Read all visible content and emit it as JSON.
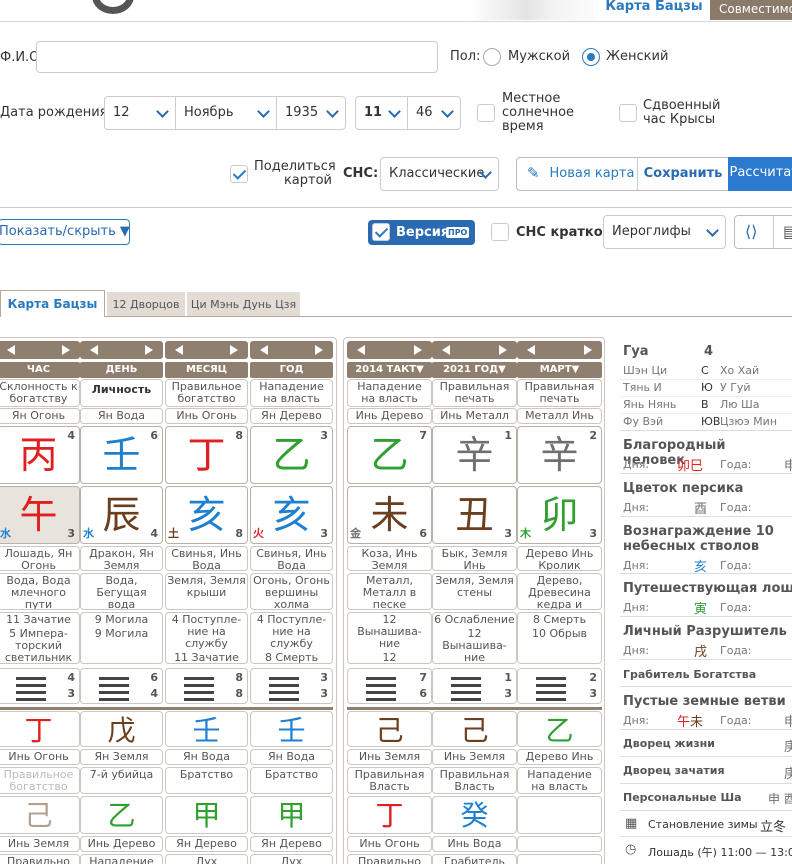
{
  "header": {
    "tab_main": "Карта Бацзы",
    "tab_compat": "Совместимость"
  },
  "form": {
    "fio_label": "Ф.И.О.",
    "fio_value": "",
    "sex_label": "Пол:",
    "male": "Мужской",
    "female": "Женский",
    "sex_selected": "Женский",
    "dob_label": "Дата рождения",
    "day": "12",
    "month": "Ноябрь",
    "year": "1935",
    "hour": "11",
    "minute": "46",
    "local_solar": "Местное солнечное время",
    "double_rat": "Сдвоенный час Крысы",
    "share_label": "Поделиться картой",
    "cnc_label": "СНС:",
    "cnc_value": "Классические",
    "new_card": "Новая карта",
    "save": "Сохранить",
    "calc": "Рассчитать"
  },
  "toolbar": {
    "show_hide": "Показать/скрыть ▼",
    "version": "Версия",
    "pro": "ПРО",
    "cnc_short": "СНС кратко",
    "hieroglyphs": "Иероглифы"
  },
  "chart_tabs": [
    "Карта Бацзы",
    "12 Дворцов",
    "Ци Мэнь Дунь Цзя"
  ],
  "left": {
    "heads": [
      "ЧАС",
      "ДЕНЬ",
      "МЕСЯЦ",
      "ГОД"
    ],
    "gods": [
      "Склонность к богатству",
      "Личность",
      "Правильное богатство",
      "Нападение на власть"
    ],
    "stem_lbl": [
      "Ян Огонь",
      "Ян Вода",
      "Инь Огонь",
      "Ян Дерево"
    ],
    "stems": [
      "丙",
      "壬",
      "丁",
      "乙"
    ],
    "stem_nums": [
      "4",
      "6",
      "8",
      "3"
    ],
    "branches": [
      "午",
      "辰",
      "亥",
      "亥"
    ],
    "branch_el": [
      "水",
      "水",
      "土",
      "火"
    ],
    "branch_nums": [
      "3",
      "4",
      "8",
      "3"
    ],
    "animals": [
      "Лошадь, Ян Огонь",
      "Дракон, Ян Земля",
      "Свинья, Инь Вода",
      "Свинья, Инь Вода"
    ],
    "nayin": [
      "Вода, Вода млечного пути",
      "Вода, Бегущая вода",
      "Земля, Земля крыши",
      "Огонь, Огонь вершины холма"
    ],
    "stages": [
      [
        "11 Зачатие",
        "5 Импера-торский светильник"
      ],
      [
        "9 Могила",
        "9 Могила"
      ],
      [
        "4 Поступле-ние на службу",
        "11 Зачатие"
      ],
      [
        "4 Поступле-ние на службу",
        "8 Смерть"
      ]
    ],
    "hex_nums": [
      [
        "4",
        "3"
      ],
      [
        "6",
        "4"
      ],
      [
        "8",
        "8"
      ],
      [
        "3",
        "3"
      ]
    ],
    "hidden1": [
      "丁",
      "戊",
      "壬",
      "壬"
    ],
    "hidden1_lbl": [
      "Инь Огонь",
      "Ян Земля",
      "Ян Вода",
      "Ян Вода"
    ],
    "hidden1_god": [
      "Правильное богатство",
      "7-й убийца",
      "Братство",
      "Братство"
    ],
    "hidden2": [
      "己",
      "乙",
      "甲",
      "甲"
    ],
    "hidden2_lbl": [
      "Инь Земля",
      "Инь Дерево",
      "Ян Дерево",
      "Ян Дерево"
    ],
    "hidden2_god": [
      "Правильно",
      "Нападение на",
      "Дух",
      "Дух"
    ]
  },
  "mid": {
    "heads": [
      "2014 ТАКТ▼",
      "2021 ГОД▼",
      "МАРТ▼"
    ],
    "gods": [
      "Нападение на власть",
      "Правильная печать",
      "Правильная печать"
    ],
    "stem_lbl": [
      "Инь Дерево",
      "Инь Металл",
      "Металл Инь"
    ],
    "stems": [
      "乙",
      "辛",
      "辛"
    ],
    "stem_nums": [
      "7",
      "1",
      "2"
    ],
    "branches": [
      "未",
      "丑",
      "卯"
    ],
    "branch_el": [
      "金",
      "",
      ""
    ],
    "branch_el2": [
      "",
      "",
      "木"
    ],
    "branch_nums": [
      "6",
      "3",
      "3"
    ],
    "animals": [
      "Коза, Инь Земля",
      "Бык, Земля Инь",
      "Дерево Инь Кролик"
    ],
    "nayin": [
      "Металл, Металл в песке",
      "Земля, Земля стены",
      "Дерево, Древесина кедра и сосны"
    ],
    "stages": [
      [
        "12 Вынашива-ние",
        "12 Вынашива-ние"
      ],
      [
        "6 Ослабление",
        "12 Вынашива-ние"
      ],
      [
        "8 Смерть",
        "10 Обрыв"
      ]
    ],
    "hex_nums": [
      [
        "7",
        "6"
      ],
      [
        "1",
        "3"
      ],
      [
        "2",
        "3"
      ]
    ],
    "hidden1": [
      "己",
      "己",
      "乙"
    ],
    "hidden1_lbl": [
      "Инь Земля",
      "Инь Земля",
      "Дерево Инь"
    ],
    "hidden1_god": [
      "Правильная Власть",
      "Правильная Власть",
      "Нападение на власть"
    ],
    "hidden2": [
      "丁",
      "癸",
      ""
    ],
    "hidden2_lbl": [
      "Инь Огонь",
      "Инь Вода",
      ""
    ],
    "hidden2_god": [
      "Правильно",
      "Грабитель",
      ""
    ]
  },
  "right": {
    "gua_label": "Гуа",
    "gua_value": "4",
    "rows": [
      [
        "Шэн Ци",
        "С",
        "Хо Хай"
      ],
      [
        "Тянь И",
        "Ю",
        "У Гуй"
      ],
      [
        "Янь Нянь",
        "В",
        "Лю Ша"
      ],
      [
        "Фу Вэй",
        "ЮВ",
        "Цзюэ Мин"
      ]
    ],
    "noble": "Благородный человек",
    "noble_day": "卯巳",
    "noble_year": "申",
    "peach": "Цветок персика",
    "peach_day": "酉",
    "reward": "Вознаграждение 10 небесных стволов",
    "reward_day": "亥",
    "horse": "Путешествующая лошадь",
    "horse_day": "寅",
    "destroyer": "Личный Разрушитель",
    "destroyer_day": "戌",
    "robber": "Грабитель Богатства",
    "empty": "Пустые земные ветви",
    "empty_day": "午未",
    "empty_year": "申",
    "life": "Дворец жизни",
    "life_v": "庚",
    "concept": "Дворец зачатия",
    "concept_v": "庚",
    "sha": "Персональные Ша",
    "sha_v": "申 酉",
    "winter": "Становление зимы",
    "winter_v": "立冬",
    "horse_time": "Лошадь (午) 11:00 — 13:00",
    "day_lbl": "Дня:",
    "year_lbl": "Года:"
  }
}
